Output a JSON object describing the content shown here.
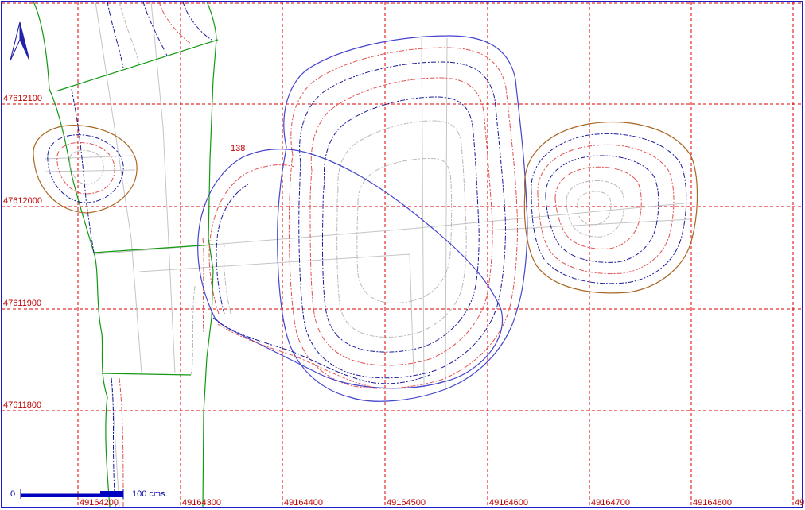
{
  "map": {
    "grid_x_labels": [
      "49164200",
      "49164300",
      "49164400",
      "49164500",
      "49164600",
      "49164700",
      "49164800",
      "49"
    ],
    "grid_y_labels": [
      "47612100",
      "47612000",
      "47611900",
      "47611800"
    ],
    "contour_label": "138",
    "scale_bar": {
      "start_label": "0",
      "end_label": "100 cms."
    },
    "north_arrow_icon": "north-arrow-icon",
    "colors": {
      "grid": "#e00000",
      "frame": "#1c1cc8",
      "boundary_green": "#119911",
      "outline_blue": "#4444cc",
      "outline_brown": "#aa6622",
      "contour_red": "#e05050",
      "contour_blue": "#1a1a99",
      "contour_gray": "#b8b8b8"
    }
  }
}
